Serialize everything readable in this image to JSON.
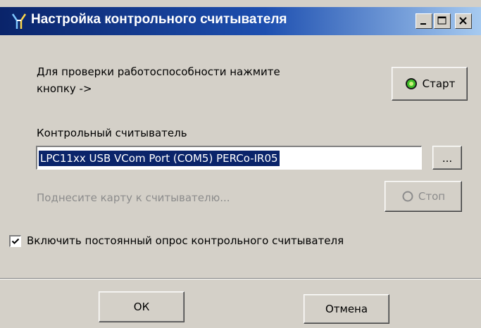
{
  "window": {
    "title": "Настройка контрольного считывателя"
  },
  "instruction": {
    "line1": "Для проверки работоспособности нажмите",
    "line2": "кнопку ->"
  },
  "start_button": {
    "label": "Старт",
    "icon": "green-circle-icon"
  },
  "reader": {
    "label": "Контрольный считыватель",
    "value": "LPC11xx USB VCom Port (COM5) PERCo-IR05",
    "browse_label": "..."
  },
  "hint_text": "Поднесите карту к считывателю...",
  "stop_button": {
    "label": "Стоп",
    "icon": "gray-circle-icon",
    "enabled": false
  },
  "polling_checkbox": {
    "label": "Включить постоянный опрос контрольного считывателя",
    "checked": true
  },
  "footer": {
    "ok_label": "ОК",
    "cancel_label": "Отмена"
  },
  "colors": {
    "title_bar_start": "#0a246a",
    "title_bar_end": "#a6caf0",
    "dialog_face": "#d4d0c8",
    "selection": "#0a246a",
    "disabled_text": "#8c8c8c"
  }
}
